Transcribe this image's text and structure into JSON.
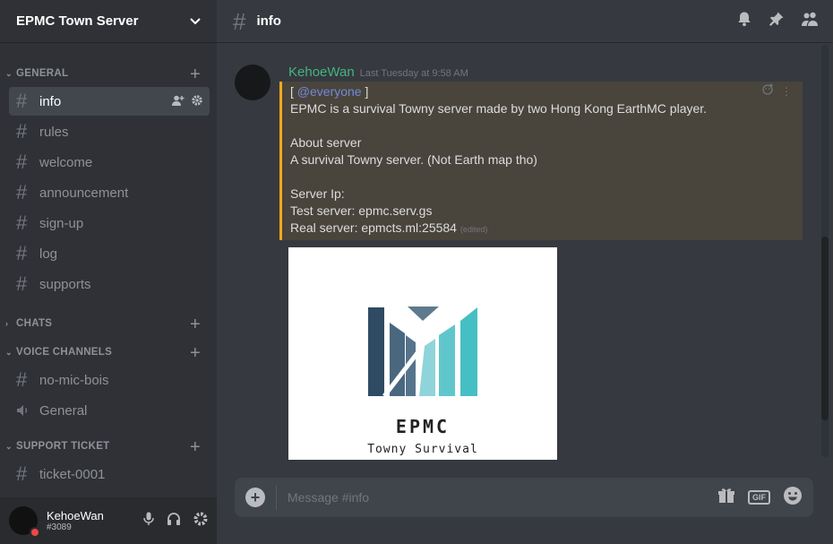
{
  "server": {
    "name": "EPMC Town Server"
  },
  "categories": {
    "general": "GENERAL",
    "chats": "CHATS",
    "voice": "VOICE CHANNELS",
    "support": "SUPPORT TICKET"
  },
  "channels": {
    "general": [
      "info",
      "rules",
      "welcome",
      "announcement",
      "sign-up",
      "log",
      "supports"
    ],
    "voice": [
      "no-mic-bois",
      "General"
    ],
    "support": [
      "ticket-0001"
    ]
  },
  "user": {
    "name": "KehoeWan",
    "tag": "#3089"
  },
  "header": {
    "channel": "info"
  },
  "message": {
    "author": "KehoeWan",
    "timestamp": "Last Tuesday at 9:58 AM",
    "mention_open": "[ ",
    "mention": "@everyone",
    "mention_close": " ]",
    "line1": "EPMC is a survival Towny server made by two Hong Kong EarthMC player.",
    "about_title": "About server",
    "about_text": "A survival Towny server. (Not Earth map tho)",
    "ip_title": "Server Ip:",
    "test_server": "Test server: epmc.serv.gs",
    "real_server": "Real server: epmcts.ml:25584",
    "edited": "(edited)"
  },
  "image": {
    "title": "EPMC",
    "subtitle": "Towny Survival"
  },
  "composer": {
    "placeholder": "Message #info"
  },
  "colors": {
    "accent": "#7289da",
    "mention_bar": "#faa61a",
    "author": "#43b581",
    "dnd": "#f04747"
  }
}
